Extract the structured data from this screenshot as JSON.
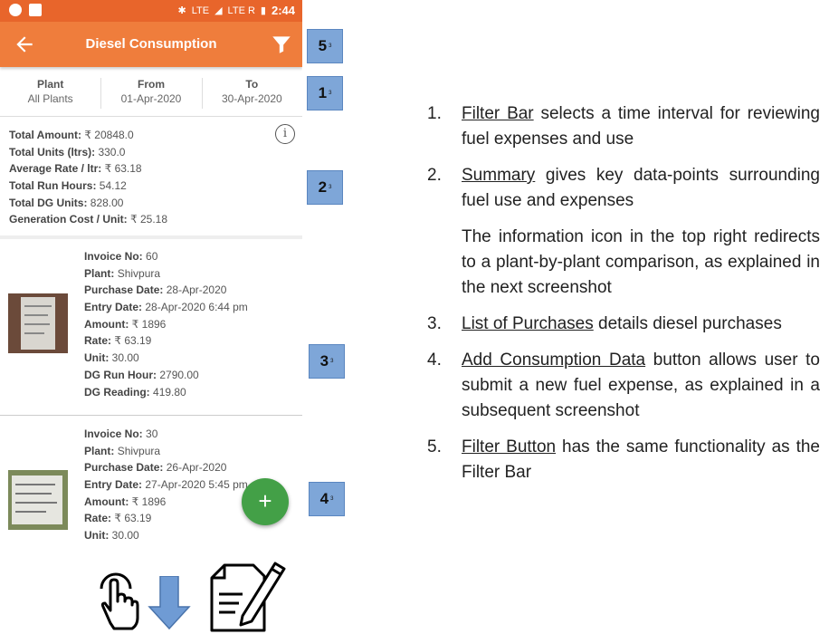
{
  "status_bar": {
    "time": "2:44",
    "signal_text_1": "LTE",
    "signal_text_2": "LTE R"
  },
  "app_bar": {
    "title": "Diesel Consumption"
  },
  "filter_bar": [
    {
      "label": "Plant",
      "value": "All Plants"
    },
    {
      "label": "From",
      "value": "01-Apr-2020"
    },
    {
      "label": "To",
      "value": "30-Apr-2020"
    }
  ],
  "summary": {
    "rows": [
      {
        "label": "Total Amount:",
        "value": "₹ 20848.0"
      },
      {
        "label": "Total Units (ltrs):",
        "value": "330.0"
      },
      {
        "label": "Average Rate / ltr:",
        "value": "₹ 63.18"
      },
      {
        "label": "Total Run Hours:",
        "value": "54.12"
      },
      {
        "label": "Total DG Units:",
        "value": "828.00"
      },
      {
        "label": "Generation Cost / Unit:",
        "value": "₹ 25.18"
      }
    ],
    "info_glyph": "i"
  },
  "purchases": [
    {
      "lines": [
        {
          "label": "Invoice No:",
          "value": "60"
        },
        {
          "label": "Plant:",
          "value": "Shivpura"
        },
        {
          "label": "Purchase Date:",
          "value": "28-Apr-2020"
        },
        {
          "label": "Entry Date:",
          "value": "28-Apr-2020 6:44 pm"
        },
        {
          "label": "Amount:",
          "value": "₹ 1896"
        },
        {
          "label": "Rate:",
          "value": "₹ 63.19"
        },
        {
          "label": "Unit:",
          "value": "30.00"
        },
        {
          "label": "DG Run Hour:",
          "value": "2790.00"
        },
        {
          "label": "DG Reading:",
          "value": "419.80"
        }
      ]
    },
    {
      "lines": [
        {
          "label": "Invoice No:",
          "value": "30"
        },
        {
          "label": "Plant:",
          "value": "Shivpura"
        },
        {
          "label": "Purchase Date:",
          "value": "26-Apr-2020"
        },
        {
          "label": "Entry Date:",
          "value": "27-Apr-2020 5:45 pm"
        },
        {
          "label": "Amount:",
          "value": "₹ 1896"
        },
        {
          "label": "Rate:",
          "value": "₹ 63.19"
        },
        {
          "label": "Unit:",
          "value": "30.00"
        }
      ]
    }
  ],
  "fab": {
    "symbol": "+"
  },
  "callouts": [
    {
      "num": "5",
      "sub": "3"
    },
    {
      "num": "1",
      "sub": "3"
    },
    {
      "num": "2",
      "sub": "3"
    },
    {
      "num": "3",
      "sub": "3"
    },
    {
      "num": "4",
      "sub": "3"
    }
  ],
  "notes": [
    {
      "num": "1.",
      "title": "Filter Bar",
      "text": " selects a time interval for reviewing fuel expenses and use"
    },
    {
      "num": "2.",
      "title": "Summary",
      "text": " gives key data-points surrounding fuel use and expenses"
    },
    {
      "num": "",
      "title": "",
      "text": "The information icon in the top right redirects to a plant-by-plant comparison, as explained in the next screenshot"
    },
    {
      "num": "3.",
      "title": "List of Purchases",
      "text": " details diesel purchases"
    },
    {
      "num": "4.",
      "title": "Add Consumption Data",
      "text": " button allows user to submit a new fuel expense, as explained in a subsequent screenshot"
    },
    {
      "num": "5.",
      "title": "Filter Button",
      "text": " has the same functionality as the Filter Bar"
    }
  ],
  "colors": {
    "status_bar": "#e8652b",
    "app_bar": "#ef7d3c",
    "fab": "#43a047",
    "callout": "#7ea6d8"
  }
}
